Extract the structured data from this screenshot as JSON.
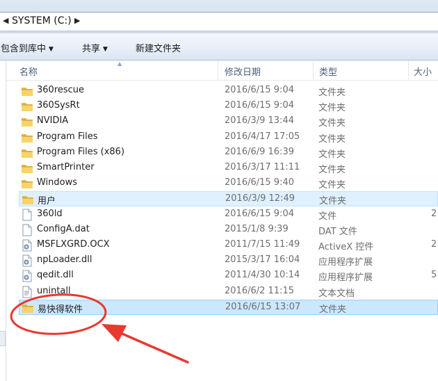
{
  "address": {
    "path": "SYSTEM (C:)"
  },
  "toolbar": {
    "include_label": "包含到库中",
    "share_label": "共享",
    "new_folder_label": "新建文件夹"
  },
  "columns": {
    "name": "名称",
    "date": "修改日期",
    "type": "类型",
    "size": "大小"
  },
  "files": [
    {
      "name": "360rescue",
      "date": "2016/6/15 9:04",
      "type": "文件夹",
      "size": "",
      "icon": "folder-icon"
    },
    {
      "name": "360SysRt",
      "date": "2016/6/15 9:04",
      "type": "文件夹",
      "size": "",
      "icon": "folder-icon"
    },
    {
      "name": "NVIDIA",
      "date": "2016/3/9 13:44",
      "type": "文件夹",
      "size": "",
      "icon": "folder-icon"
    },
    {
      "name": "Program Files",
      "date": "2016/4/17 17:05",
      "type": "文件夹",
      "size": "",
      "icon": "folder-icon"
    },
    {
      "name": "Program Files (x86)",
      "date": "2016/6/9 16:39",
      "type": "文件夹",
      "size": "",
      "icon": "folder-icon"
    },
    {
      "name": "SmartPrinter",
      "date": "2016/3/17 11:11",
      "type": "文件夹",
      "size": "",
      "icon": "folder-icon"
    },
    {
      "name": "Windows",
      "date": "2016/6/15 9:40",
      "type": "文件夹",
      "size": "",
      "icon": "folder-icon"
    },
    {
      "name": "用户",
      "date": "2016/3/9 12:49",
      "type": "文件夹",
      "size": "",
      "icon": "folder-icon"
    },
    {
      "name": "360ld",
      "date": "2016/6/15 9:04",
      "type": "文件",
      "size": "2",
      "icon": "file-icon"
    },
    {
      "name": "ConfigA.dat",
      "date": "2015/1/8 9:39",
      "type": "DAT 文件",
      "size": "",
      "icon": "file-icon"
    },
    {
      "name": "MSFLXGRD.OCX",
      "date": "2011/7/15 11:49",
      "type": "ActiveX 控件",
      "size": "2",
      "icon": "settings-file-icon"
    },
    {
      "name": "npLoader.dll",
      "date": "2015/3/17 16:04",
      "type": "应用程序扩展",
      "size": "",
      "icon": "settings-file-icon"
    },
    {
      "name": "qedit.dll",
      "date": "2011/4/30 10:14",
      "type": "应用程序扩展",
      "size": "5",
      "icon": "settings-file-icon"
    },
    {
      "name": "unintall",
      "date": "2016/6/2 11:15",
      "type": "文本文档",
      "size": "",
      "icon": "text-file-icon"
    },
    {
      "name": "易快得软件",
      "date": "2016/6/15 13:07",
      "type": "文件夹",
      "size": "",
      "icon": "folder-icon"
    }
  ],
  "colors": {
    "selection": "#cce8ff",
    "annotation": "#e8382f",
    "folder": "#f2c94c"
  }
}
